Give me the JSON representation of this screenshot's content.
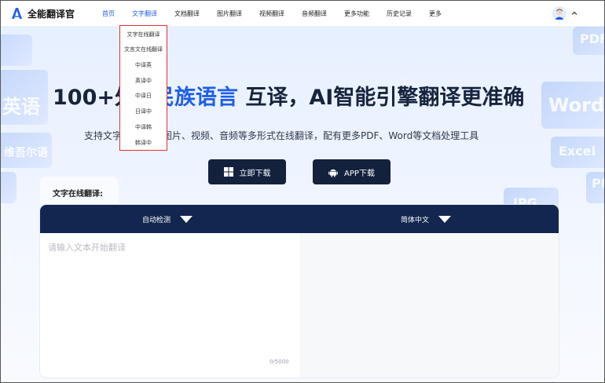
{
  "app": {
    "logo_text": "全能翻译官"
  },
  "nav": {
    "items": [
      {
        "label": "首页"
      },
      {
        "label": "文字翻译"
      },
      {
        "label": "文档翻译"
      },
      {
        "label": "图片翻译"
      },
      {
        "label": "视频翻译"
      },
      {
        "label": "音频翻译"
      },
      {
        "label": "更多功能"
      },
      {
        "label": "历史记录"
      },
      {
        "label": "更多"
      }
    ]
  },
  "dropdown": {
    "items": [
      {
        "label": "文字在线翻译"
      },
      {
        "label": "文言文在线翻译"
      },
      {
        "label": "中译英"
      },
      {
        "label": "英译中"
      },
      {
        "label": "中译日"
      },
      {
        "label": "日译中"
      },
      {
        "label": "中译韩"
      },
      {
        "label": "韩译中"
      }
    ]
  },
  "hero": {
    "headline_prefix": "100+外",
    "headline_blue": "民族语言",
    "headline_suffix": "互译，AI智能引擎翻译更准确",
    "subline_left": "支持文字",
    "subline_right": "图片、视频、音频等多形式在线翻译，配有更多PDF、Word等文档处理工具",
    "download_button": "立即下载",
    "app_button": "APP下载",
    "deco_left": [
      "英语",
      "维吾尔语"
    ],
    "deco_right": [
      "PDF",
      "Word",
      "Excel",
      "PPT",
      "JPG"
    ]
  },
  "translator": {
    "tab_label": "文字在线翻译:",
    "source_lang": "自动检测",
    "target_lang": "简体中文",
    "placeholder": "请输入文本开始翻译",
    "counter": "0/5000"
  },
  "colors": {
    "accent": "#1f5ee8",
    "dark": "#14213d",
    "panel_bar": "#12264f",
    "dropdown_border": "#e03131"
  }
}
